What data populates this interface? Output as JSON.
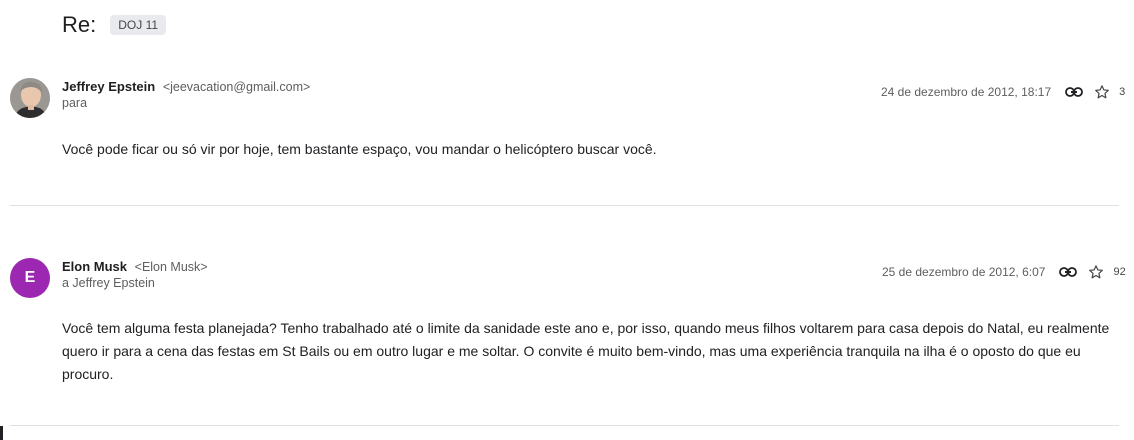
{
  "thread": {
    "subject": "Re:",
    "label": "DOJ 11"
  },
  "messages": [
    {
      "sender_name": "Jeffrey Epstein",
      "sender_email": "<jeevacation@gmail.com>",
      "recipient_line": "para",
      "date": "24 de dezembro de 2012, 18:17",
      "star_count": "3",
      "body": "Você pode ficar ou só vir por hoje, tem bastante espaço, vou mandar o helicóptero buscar você."
    },
    {
      "avatar_letter": "E",
      "sender_name": "Elon Musk",
      "sender_email": "<Elon Musk>",
      "recipient_line": "a Jeffrey Epstein",
      "date": "25 de dezembro de 2012, 6:07",
      "star_count": "92",
      "body": "Você tem alguma festa planejada? Tenho trabalhado até o limite da sanidade este ano e, por isso, quando meus filhos voltarem para casa depois do Natal, eu realmente quero ir para a cena das festas em St Bails ou em outro lugar e me soltar. O convite é muito bem-vindo, mas uma experiência tranquila na ilha é o oposto do que eu procuro."
    }
  ],
  "colors": {
    "avatar_letter_bg": "#9c27b0",
    "label_chip_bg": "#e8eaed",
    "divider": "#e0e0e0"
  },
  "icons": {
    "link": "link-icon",
    "star": "star-icon"
  }
}
